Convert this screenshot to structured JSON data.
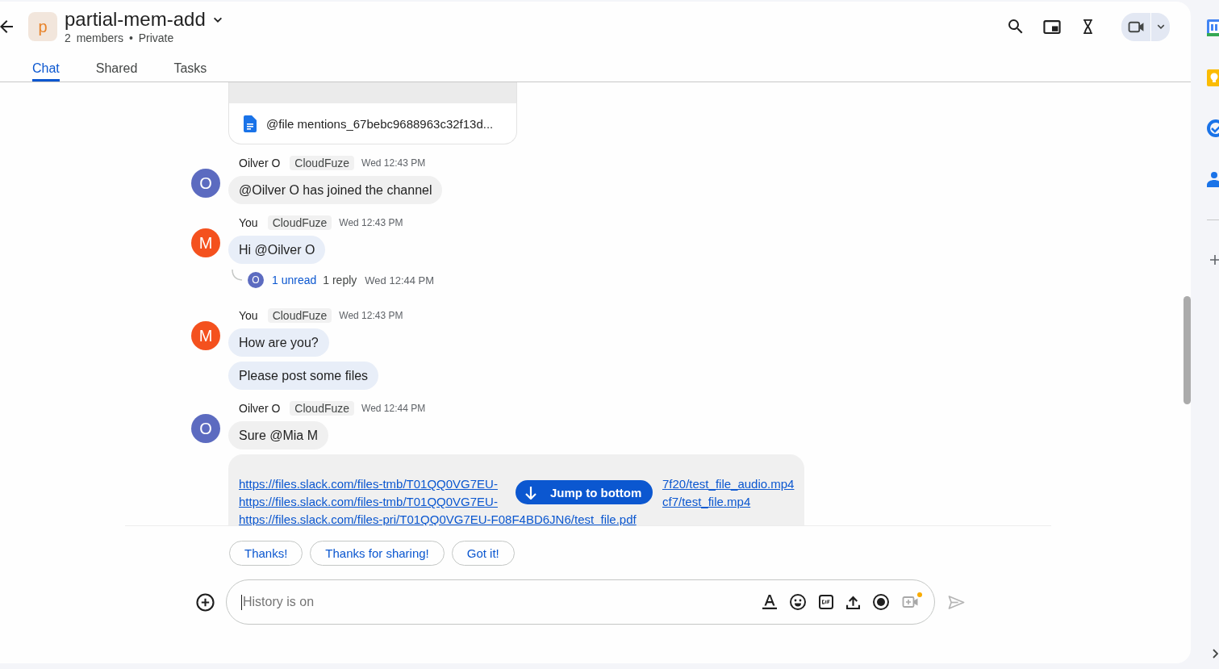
{
  "header": {
    "avatar_letter": "p",
    "title": "partial-mem-add",
    "subtitle": "2 members • Private"
  },
  "tabs": [
    {
      "label": "Chat",
      "selected": true
    },
    {
      "label": "Shared",
      "selected": false
    },
    {
      "label": "Tasks",
      "selected": false
    }
  ],
  "file_card": {
    "name": "@file mentions_67bebc9688963c32f13d..."
  },
  "message_groups": [
    {
      "sender": "Oilver O",
      "avatar_letter": "O",
      "color": "#5c6bc0",
      "tag": "CloudFuze",
      "time": "Wed 12:43 PM",
      "bubbles": [
        {
          "kind": "text",
          "text": "@Oilver O has joined the channel",
          "color": "#f0f0f0"
        }
      ]
    },
    {
      "sender": "You",
      "avatar_letter": "M",
      "color": "#f4511e",
      "tag": "CloudFuze",
      "time": "Wed 12:43 PM",
      "bubbles": [
        {
          "kind": "text",
          "text": "Hi @Oilver O",
          "color": "#e8eef8"
        }
      ],
      "thread": {
        "avatar_letter": "O",
        "color": "#5c6bc0",
        "unread": "1 unread",
        "replies": "1 reply",
        "time": "Wed 12:44 PM"
      }
    },
    {
      "sender": "You",
      "avatar_letter": "M",
      "color": "#f4511e",
      "tag": "CloudFuze",
      "time": "Wed 12:43 PM",
      "bubbles": [
        {
          "kind": "text",
          "text": "How are you?",
          "color": "#e8eef8"
        },
        {
          "kind": "text",
          "text": "Please post some files",
          "color": "#e8eef8"
        }
      ]
    },
    {
      "sender": "Oilver O",
      "avatar_letter": "O",
      "color": "#5c6bc0",
      "tag": "CloudFuze",
      "time": "Wed 12:44 PM",
      "bubbles": [
        {
          "kind": "text",
          "text": "Sure @Mia M",
          "color": "#f0f0f0"
        },
        {
          "kind": "links",
          "color": "#f0f0f0",
          "links": [
            {
              "kind": "split",
              "start": "https://files.slack.com/files-tmb/T01QQ0VG7EU-",
              "end": "7f20/test_file_audio.mp4"
            },
            {
              "kind": "split",
              "start": "https://files.slack.com/files-tmb/T01QQ0VG7EU-",
              "end": "cf7/test_file.mp4"
            },
            {
              "kind": "whole",
              "text": "https://files.slack.com/files-pri/T01QQ0VG7EU-F08F4BD6JN6/test_file.pdf"
            }
          ]
        }
      ]
    }
  ],
  "jump_button": {
    "label": "Jump to bottom"
  },
  "suggestions": [
    {
      "label": "Thanks!"
    },
    {
      "label": "Thanks for sharing!"
    },
    {
      "label": "Got it!"
    }
  ],
  "composer": {
    "placeholder": "History is on",
    "video_disabled": true,
    "video_badge": true,
    "send_disabled": true
  }
}
